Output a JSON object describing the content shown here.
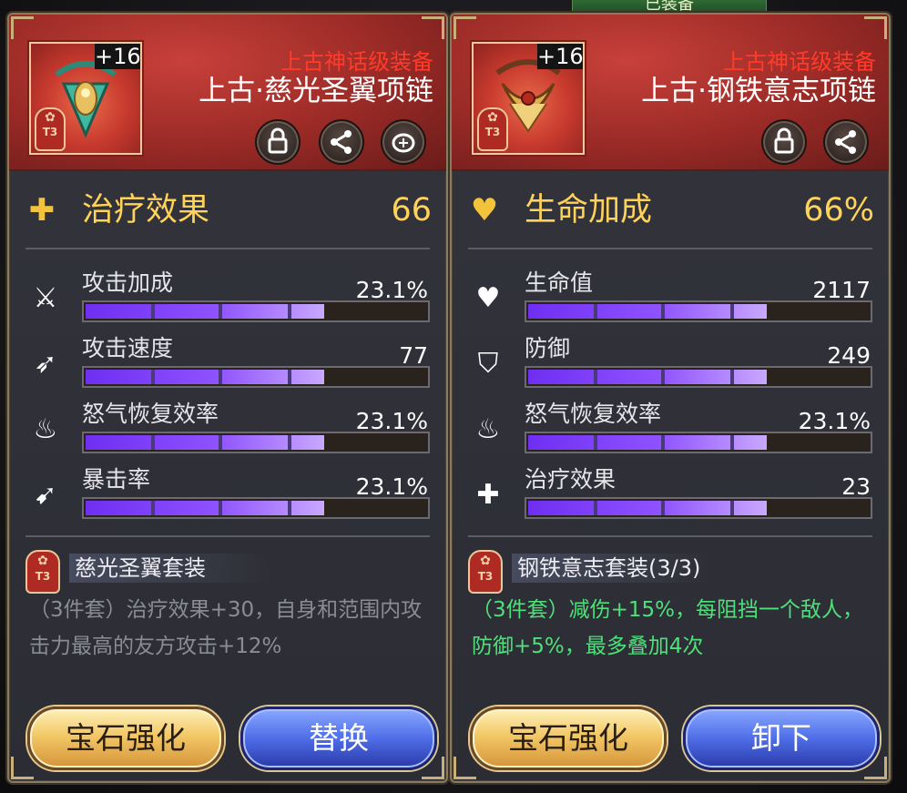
{
  "top_tab": {
    "label": "已装备"
  },
  "left_panel": {
    "item": {
      "enhance": "+16",
      "tier": "T3",
      "grade": "上古神话级装备",
      "name": "上古·慈光圣翼项链"
    },
    "header_buttons": [
      "lock-icon",
      "share-icon",
      "coins-icon"
    ],
    "main_stat": {
      "label": "治疗效果",
      "value": "66",
      "icon": "heal-plus-icon"
    },
    "substats": [
      {
        "label": "攻击加成",
        "value": "23.1%",
        "icon": "sword-percent-icon",
        "fill": 0.7
      },
      {
        "label": "攻击速度",
        "value": "77",
        "icon": "speed-sword-icon",
        "fill": 0.7
      },
      {
        "label": "怒气恢复效率",
        "value": "23.1%",
        "icon": "flame-icon",
        "fill": 0.7
      },
      {
        "label": "暴击率",
        "value": "23.1%",
        "icon": "crit-arrow-icon",
        "fill": 0.7
      }
    ],
    "set": {
      "tier": "T3",
      "title": "慈光圣翼套装",
      "desc": "（3件套）治疗效果+30，自身和范围内攻击力最高的友方攻击+12%"
    },
    "buttons": {
      "gem": "宝石强化",
      "action": "替换"
    }
  },
  "right_panel": {
    "item": {
      "enhance": "+16",
      "tier": "T3",
      "grade": "上古神话级装备",
      "name": "上古·钢铁意志项链"
    },
    "header_buttons": [
      "lock-icon",
      "share-icon"
    ],
    "main_stat": {
      "label": "生命加成",
      "value": "66%",
      "icon": "heart-percent-icon"
    },
    "substats": [
      {
        "label": "生命值",
        "value": "2117",
        "icon": "heart-icon",
        "fill": 0.7
      },
      {
        "label": "防御",
        "value": "249",
        "icon": "shield-icon",
        "fill": 0.7
      },
      {
        "label": "怒气恢复效率",
        "value": "23.1%",
        "icon": "flame-icon",
        "fill": 0.7
      },
      {
        "label": "治疗效果",
        "value": "23",
        "icon": "heal-plus-icon",
        "fill": 0.7
      }
    ],
    "set": {
      "tier": "T3",
      "title": "钢铁意志套装(3/3)",
      "desc": "（3件套）减伤+15%，每阻挡一个敌人，防御+5%，最多叠加4次"
    },
    "buttons": {
      "gem": "宝石强化",
      "action": "卸下"
    }
  }
}
